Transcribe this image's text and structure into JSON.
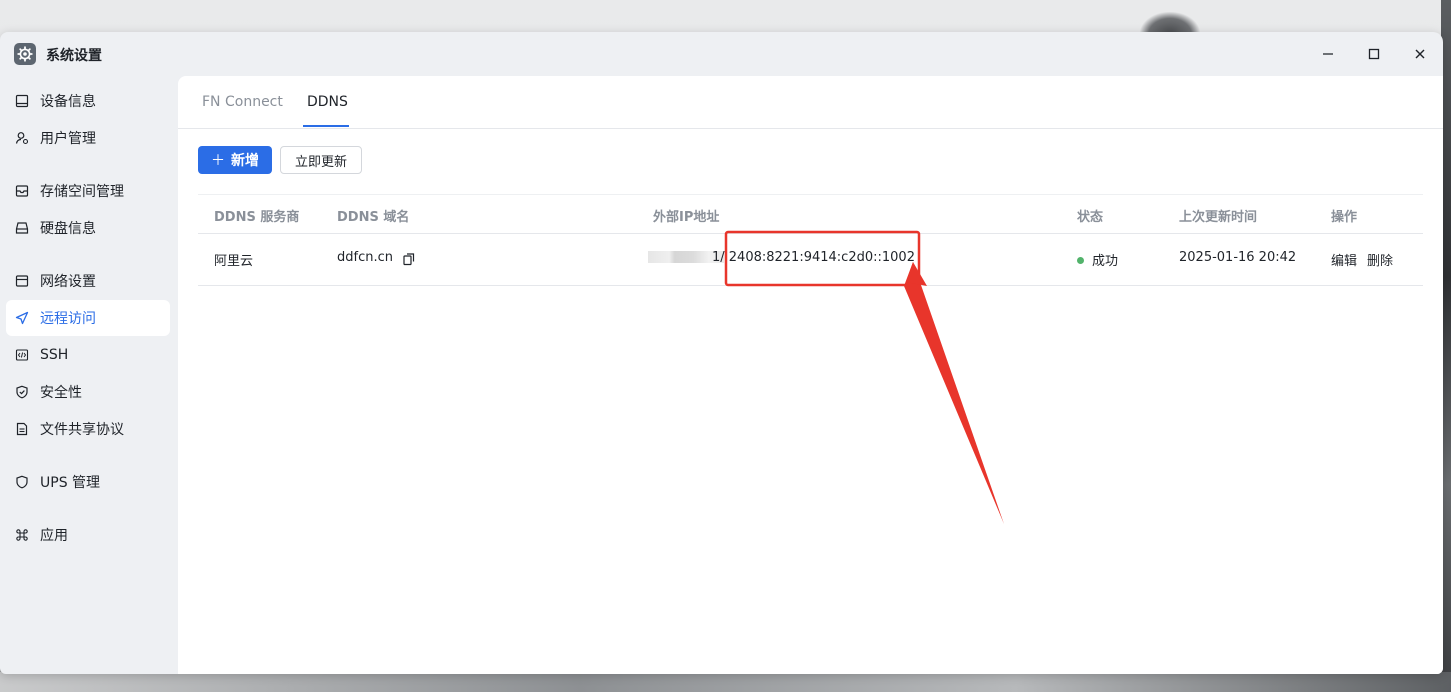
{
  "window": {
    "title": "系统设置"
  },
  "sidebar": {
    "items": [
      {
        "label": "设备信息",
        "icon": "device-icon"
      },
      {
        "label": "用户管理",
        "icon": "user-icon"
      },
      {
        "label": "存储空间管理",
        "icon": "storage-icon"
      },
      {
        "label": "硬盘信息",
        "icon": "disk-icon"
      },
      {
        "label": "网络设置",
        "icon": "network-icon"
      },
      {
        "label": "远程访问",
        "icon": "send-icon",
        "active": true
      },
      {
        "label": "SSH",
        "icon": "code-icon"
      },
      {
        "label": "安全性",
        "icon": "shield-check-icon"
      },
      {
        "label": "文件共享协议",
        "icon": "file-icon"
      },
      {
        "label": "UPS 管理",
        "icon": "shield-icon"
      },
      {
        "label": "应用",
        "icon": "command-icon"
      }
    ]
  },
  "tabs": [
    {
      "label": "FN Connect"
    },
    {
      "label": "DDNS",
      "active": true
    }
  ],
  "toolbar": {
    "add_icon": "＋",
    "add_label": "新增",
    "update_label": "立即更新"
  },
  "table": {
    "headers": [
      "DDNS 服务商",
      "DDNS 域名",
      "外部IP地址",
      "状态",
      "上次更新时间",
      "操作"
    ],
    "rows": [
      {
        "provider": "阿里云",
        "domain": "ddfcn.cn",
        "ip_visible": "1/ 2408:8221:9414:c2d0::1002",
        "status": "成功",
        "updated": "2025-01-16 20:42",
        "edit": "编辑",
        "delete": "删除"
      }
    ]
  },
  "colors": {
    "accent": "#2b6de6",
    "success": "#52b36b",
    "annotation": "#e8352b"
  }
}
